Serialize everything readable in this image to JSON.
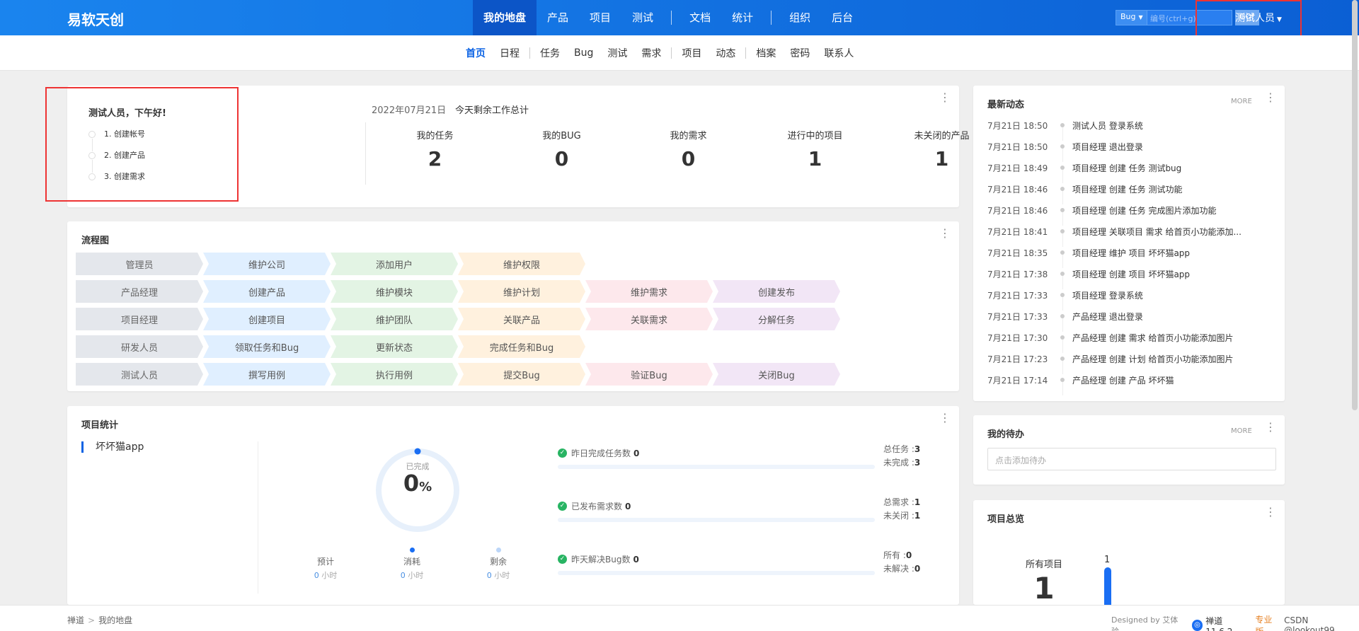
{
  "header": {
    "brand": "易软天创",
    "nav": [
      "我的地盘",
      "产品",
      "项目",
      "测试",
      "文档",
      "统计",
      "组织",
      "后台"
    ],
    "search_type": "Bug",
    "search_placeholder": "编号(ctrl+g)",
    "go": "GO!",
    "user": "测试人员"
  },
  "subnav": [
    "首页",
    "日程",
    "任务",
    "Bug",
    "测试",
    "需求",
    "项目",
    "动态",
    "档案",
    "密码",
    "联系人"
  ],
  "welcome": {
    "title": "测试人员，下午好!",
    "steps": [
      "1. 创建帐号",
      "2. 创建产品",
      "3. 创建需求"
    ],
    "date": "2022年07月21日",
    "summary_label": "今天剩余工作总计",
    "stats": [
      {
        "label": "我的任务",
        "value": "2"
      },
      {
        "label": "我的BUG",
        "value": "0"
      },
      {
        "label": "我的需求",
        "value": "0"
      },
      {
        "label": "进行中的项目",
        "value": "1"
      },
      {
        "label": "未关闭的产品",
        "value": "1"
      }
    ]
  },
  "flow": {
    "title": "流程图",
    "rows": [
      [
        "管理员",
        "维护公司",
        "添加用户",
        "维护权限"
      ],
      [
        "产品经理",
        "创建产品",
        "维护模块",
        "维护计划",
        "维护需求",
        "创建发布"
      ],
      [
        "项目经理",
        "创建项目",
        "维护团队",
        "关联产品",
        "关联需求",
        "分解任务"
      ],
      [
        "研发人员",
        "领取任务和Bug",
        "更新状态",
        "完成任务和Bug"
      ],
      [
        "测试人员",
        "撰写用例",
        "执行用例",
        "提交Bug",
        "验证Bug",
        "关闭Bug"
      ]
    ]
  },
  "project_stats": {
    "title": "项目统计",
    "project": "坏坏猫app",
    "done_label": "已完成",
    "done_value": "0",
    "done_unit": "%",
    "progress": 0,
    "mini": [
      {
        "label": "预计",
        "value": "0",
        "unit": "小时"
      },
      {
        "label": "消耗",
        "value": "0",
        "unit": "小时"
      },
      {
        "label": "剩余",
        "value": "0",
        "unit": "小时"
      }
    ],
    "rows": [
      {
        "label": "昨日完成任务数",
        "value": "0",
        "r1k": "总任务 :",
        "r1v": "3",
        "r2k": "未完成 :",
        "r2v": "3"
      },
      {
        "label": "已发布需求数",
        "value": "0",
        "r1k": "总需求 :",
        "r1v": "1",
        "r2k": "未关闭 :",
        "r2v": "1"
      },
      {
        "label": "昨天解决Bug数",
        "value": "0",
        "r1k": "所有 :",
        "r1v": "0",
        "r2k": "未解决 :",
        "r2v": "0"
      }
    ]
  },
  "feed": {
    "title": "最新动态",
    "more": "MORE",
    "items": [
      {
        "t": "7月21日 18:50",
        "c": "测试人员 登录系统"
      },
      {
        "t": "7月21日 18:50",
        "c": "项目经理 退出登录"
      },
      {
        "t": "7月21日 18:49",
        "c": "项目经理 创建 任务 测试bug"
      },
      {
        "t": "7月21日 18:46",
        "c": "项目经理 创建 任务 测试功能"
      },
      {
        "t": "7月21日 18:46",
        "c": "项目经理 创建 任务 完成图片添加功能"
      },
      {
        "t": "7月21日 18:41",
        "c": "项目经理 关联项目 需求 给首页小功能添加..."
      },
      {
        "t": "7月21日 18:35",
        "c": "项目经理 维护 项目 坏坏猫app"
      },
      {
        "t": "7月21日 17:38",
        "c": "项目经理 创建 项目 坏坏猫app"
      },
      {
        "t": "7月21日 17:33",
        "c": "项目经理 登录系统"
      },
      {
        "t": "7月21日 17:33",
        "c": "产品经理 退出登录"
      },
      {
        "t": "7月21日 17:30",
        "c": "产品经理 创建 需求 给首页小功能添加图片"
      },
      {
        "t": "7月21日 17:23",
        "c": "产品经理 创建 计划 给首页小功能添加图片"
      },
      {
        "t": "7月21日 17:14",
        "c": "产品经理 创建 产品 坏坏猫"
      }
    ]
  },
  "todo": {
    "title": "我的待办",
    "more": "MORE",
    "placeholder": "点击添加待办"
  },
  "overview": {
    "title": "项目总览",
    "label": "所有项目",
    "value": "1",
    "bar_value": "1"
  },
  "footer": {
    "crumb": [
      "禅道",
      "我的地盘"
    ],
    "designed": "Designed by 艾体验",
    "version": "禅道11.6.2",
    "pro": "专业版",
    "csdn": "CSDN @lookout99"
  },
  "colors": {
    "brand": "#0b5fd4",
    "accent": "#0c63e4",
    "highlight_box": "#e33333",
    "ok": "#28b463"
  }
}
